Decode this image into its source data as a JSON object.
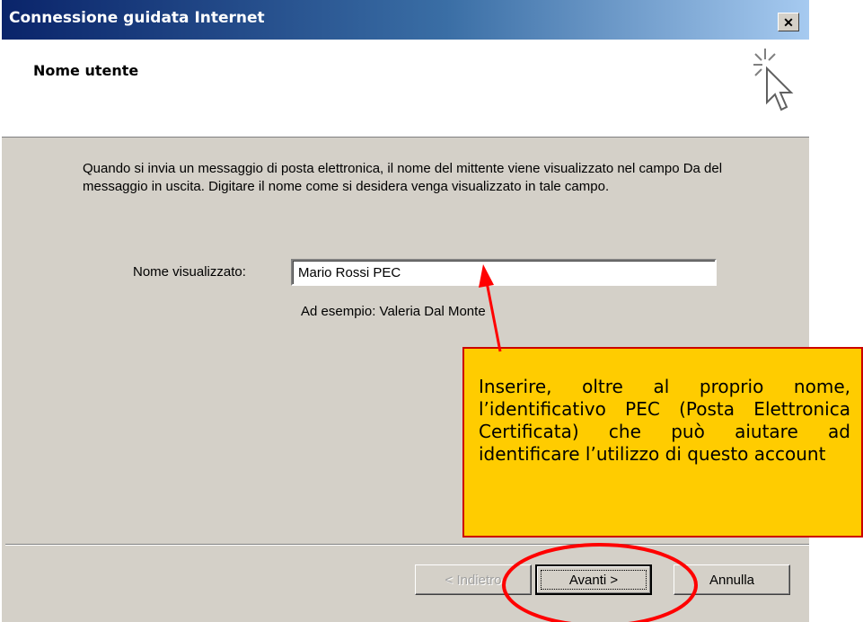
{
  "window": {
    "title": "Connessione guidata Internet",
    "close_glyph": "✕"
  },
  "header": {
    "title": "Nome utente",
    "icon": "sparkle-cursor-icon"
  },
  "content": {
    "description": "Quando si invia un messaggio di posta elettronica, il nome del mittente viene visualizzato nel campo Da del messaggio in uscita. Digitare il nome come si desidera venga visualizzato in tale campo.",
    "field_label": "Nome visualizzato:",
    "field_value": "Mario Rossi PEC",
    "example": "Ad esempio: Valeria Dal Monte"
  },
  "buttons": {
    "back": "< Indietro",
    "next": "Avanti >",
    "cancel": "Annulla"
  },
  "annotation": {
    "text": "Inserire, oltre al proprio nome, l’identificativo PEC (Posta Elettronica Certificata) che può aiutare ad identificare l’utilizzo di questo account",
    "callout_color": "#ffcc00",
    "accent_color": "#ff0000"
  },
  "colors": {
    "dialog_bg": "#d4d0c8",
    "titlebar_start": "#0a246a",
    "titlebar_end": "#a6caf0"
  }
}
